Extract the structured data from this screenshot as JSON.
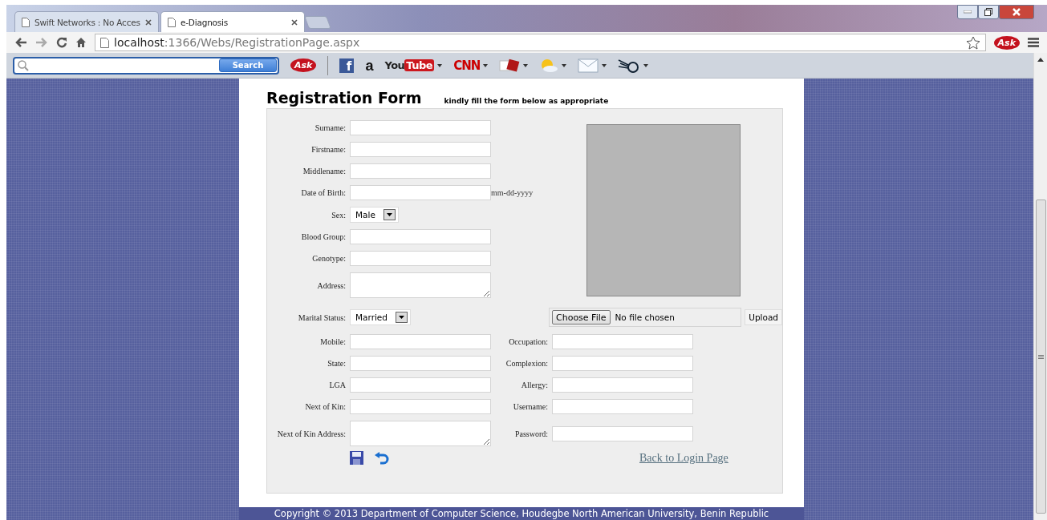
{
  "browser": {
    "tabs": [
      {
        "title": "Swift Networks : No Acces",
        "selected": false
      },
      {
        "title": "e-Diagnosis",
        "selected": true
      }
    ],
    "url_host": "localhost",
    "url_rest": ":1366/Webs/RegistrationPage.aspx",
    "ask_logo": "Ask",
    "search_button": "Search",
    "toolbar": [
      {
        "kind": "ask",
        "text": "Ask"
      },
      {
        "kind": "facebook",
        "text": "f"
      },
      {
        "kind": "amazon",
        "text": "a"
      },
      {
        "kind": "youtube",
        "text": "You",
        "text2": "Tube",
        "menu": true
      },
      {
        "kind": "cnn",
        "text": "CNN",
        "menu": true
      },
      {
        "kind": "dice",
        "menu": true
      },
      {
        "kind": "weather",
        "menu": true
      },
      {
        "kind": "mail",
        "menu": true
      },
      {
        "kind": "dial",
        "menu": true
      }
    ]
  },
  "page": {
    "title": "Registration Form",
    "subtitle": "kindly fill the form below as appropriate",
    "fields": [
      {
        "label": "Surname:",
        "kind": "text"
      },
      {
        "label": "Firstname:",
        "kind": "text"
      },
      {
        "label": "Middlename:",
        "kind": "text"
      },
      {
        "label": "Date of Birth:",
        "kind": "text",
        "hint": "mm-dd-yyyy"
      },
      {
        "label": "Sex:",
        "kind": "select",
        "value": "Male"
      },
      {
        "label": "Blood Group:",
        "kind": "text"
      },
      {
        "label": "Genotype:",
        "kind": "text"
      },
      {
        "label": "Address:",
        "kind": "textarea"
      }
    ],
    "marital": {
      "label": "Marital Status:",
      "value": "Married"
    },
    "file": {
      "button": "Choose File",
      "status": "No file chosen"
    },
    "upload": "Upload",
    "pairs": [
      {
        "left": {
          "label": "Mobile:",
          "kind": "text"
        },
        "right": "Occupation:"
      },
      {
        "left": {
          "label": "State:",
          "kind": "text"
        },
        "right": "Complexion:"
      },
      {
        "left": {
          "label": "LGA",
          "kind": "text"
        },
        "right": "Allergy:"
      },
      {
        "left": {
          "label": "Next of Kin:",
          "kind": "text"
        },
        "right": "Username:"
      },
      {
        "left": {
          "label": "Next of Kin Address:",
          "kind": "textarea"
        },
        "right": "Password:"
      }
    ],
    "back_link": "Back to Login Page",
    "footer": "Copyright © 2013 Department of Computer Science, Houdegbe North American University, Benin Republic"
  }
}
